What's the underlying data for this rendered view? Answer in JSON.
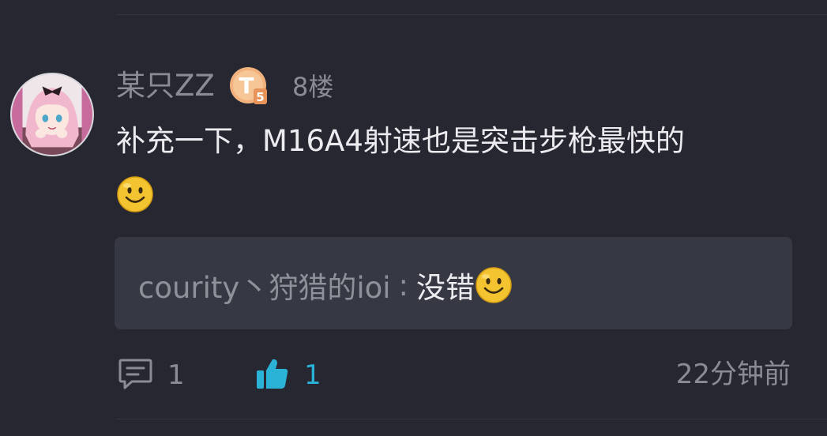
{
  "post": {
    "username": "某只ZZ",
    "level_badge": "T5",
    "floor": "8楼",
    "content": "补充一下，M16A4射速也是突击步枪最快的",
    "content_emoji": "smiley-emoji"
  },
  "reply": {
    "author": "courity丶狩猎的ioi",
    "separator": ":",
    "text": "没错",
    "emoji": "smiley-emoji"
  },
  "actions": {
    "comment_icon": "comment-icon",
    "comment_count": "1",
    "like_icon": "thumbs-up-icon",
    "like_count": "1",
    "timestamp": "22分钟前"
  },
  "colors": {
    "background": "#262730",
    "reply_background": "#363844",
    "accent": "#2ab3d6",
    "muted_text": "#8a8c95",
    "primary_text": "#ececf0",
    "badge": "#f0b27a"
  }
}
